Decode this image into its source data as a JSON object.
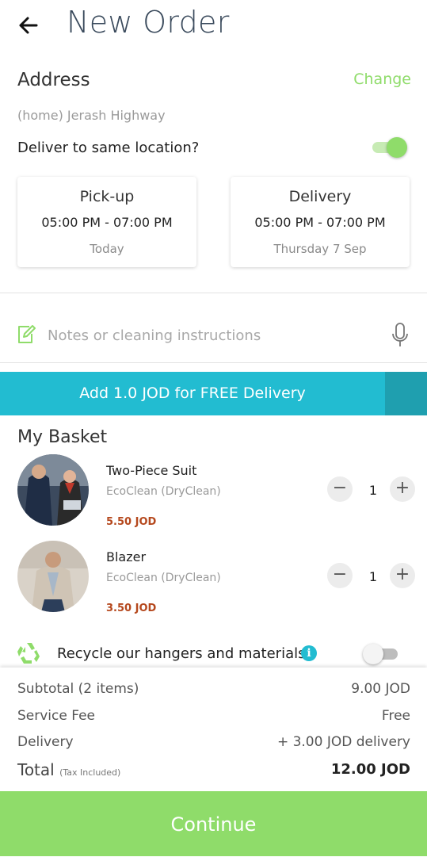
{
  "header": {
    "title": "New Order",
    "back_icon": "arrow-left-icon"
  },
  "address": {
    "label": "Address",
    "change_label": "Change",
    "value": "(home) Jerash Highway",
    "same_location_label": "Deliver to same location?",
    "same_location_enabled": true
  },
  "pickup": {
    "title": "Pick-up",
    "time": "05:00 PM - 07:00 PM",
    "day": "Today"
  },
  "delivery": {
    "title": "Delivery",
    "time": "05:00 PM - 07:00 PM",
    "day": "Thursday  7 Sep"
  },
  "notes": {
    "placeholder": "Notes or cleaning instructions",
    "icon": "edit-note-icon",
    "mic_icon": "microphone-icon"
  },
  "banner": {
    "text": "Add 1.0 JOD for FREE Delivery"
  },
  "basket": {
    "title": "My Basket",
    "items": [
      {
        "name": "Two-Piece Suit",
        "provider": "EcoClean (DryClean)",
        "price": "5.50 JOD",
        "quantity": "1"
      },
      {
        "name": "Blazer",
        "provider": "EcoClean (DryClean)",
        "price": "3.50 JOD",
        "quantity": "1"
      }
    ]
  },
  "recycle": {
    "label": "Recycle our hangers and materials",
    "enabled": false,
    "icon": "recycle-icon"
  },
  "summary": {
    "subtotal_label": "Subtotal (2 items)",
    "subtotal_value": "9.00 JOD",
    "service_fee_label": "Service Fee",
    "service_fee_value": "Free",
    "delivery_label": "Delivery",
    "delivery_value": "+ 3.00 JOD delivery",
    "total_label": "Total",
    "total_note": "(Tax Included)",
    "total_value": "12.00 JOD"
  },
  "continue_label": "Continue",
  "colors": {
    "accent_green": "#8fdc6a",
    "banner_blue": "#22bcd1",
    "price_red": "#b5481d"
  }
}
